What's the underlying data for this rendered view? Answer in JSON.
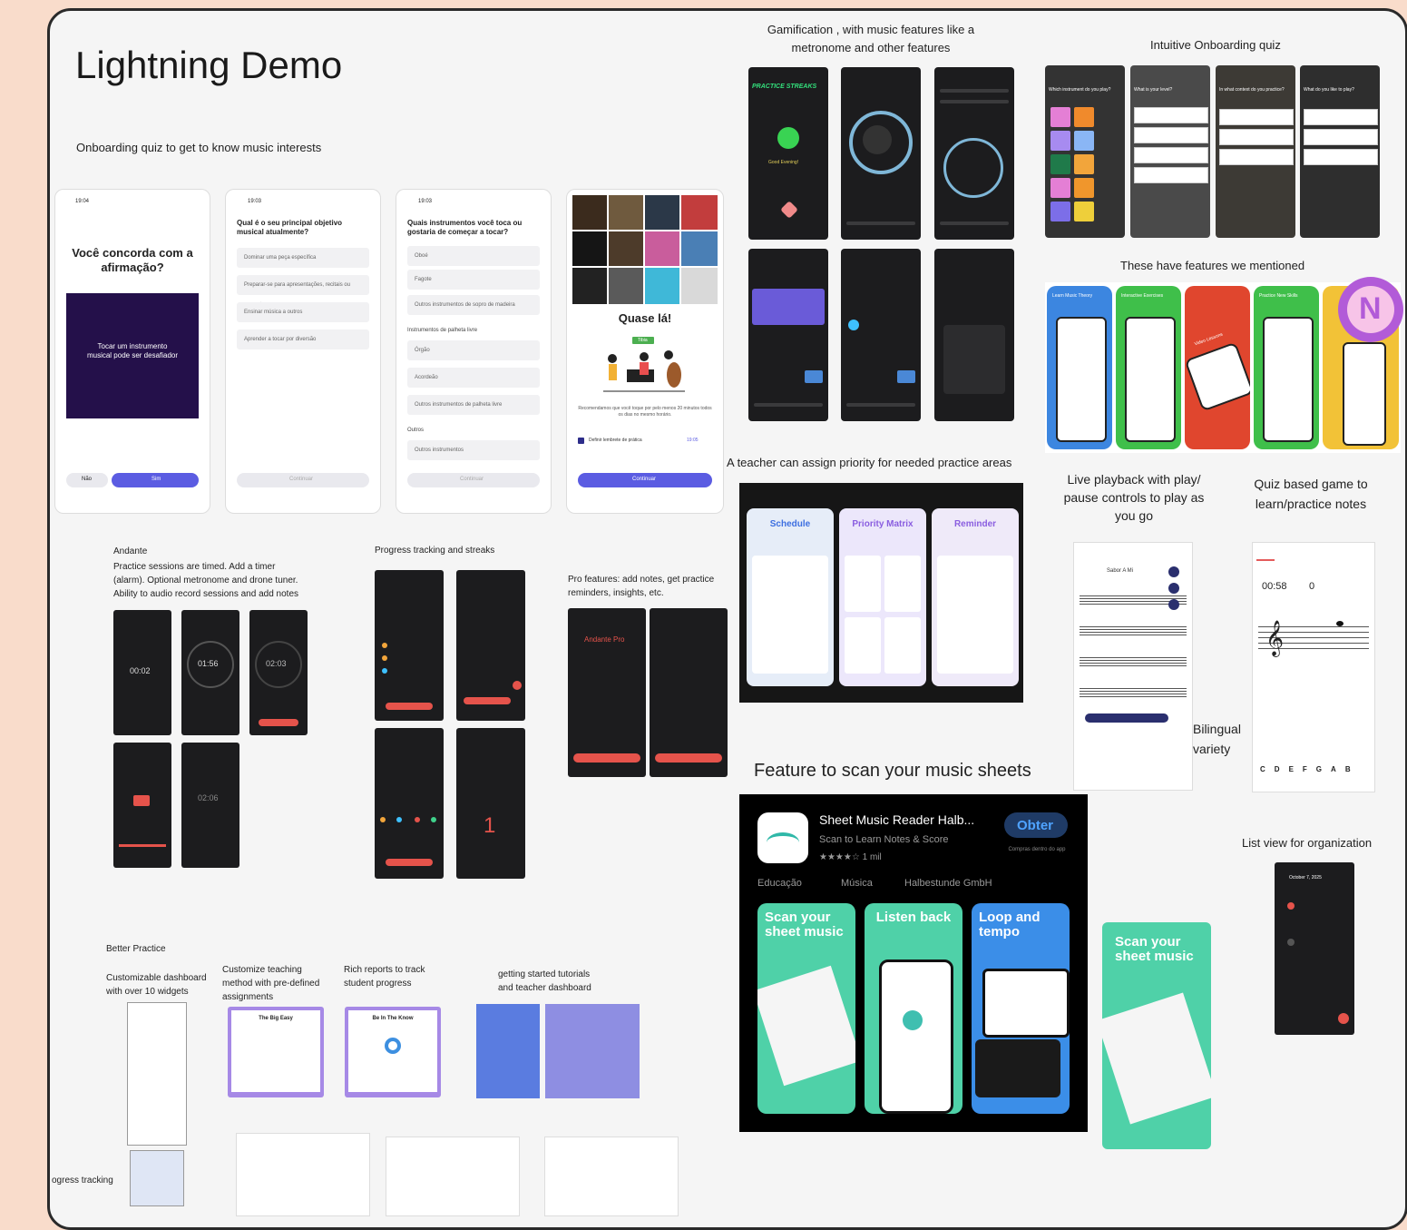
{
  "board": {
    "title": "Lightning Demo",
    "onboarding_caption": "Onboarding quiz to get to know music interests",
    "gamification_caption_1": "Gamification , with music features like a",
    "gamification_caption_2": "metronome and other features",
    "intuitive_quiz_caption": "Intuitive Onboarding quiz",
    "features_mentioned_caption": "These have features we mentioned",
    "teacher_priority_caption": "A teacher can assign priority for needed practice areas",
    "live_playback_caption_1": "Live playback with play/",
    "live_playback_caption_2": "pause controls to play as",
    "live_playback_caption_3": "you go",
    "quiz_game_caption_1": "Quiz based game to",
    "quiz_game_caption_2": "learn/practice notes",
    "bilingual_caption_1": "Bilingual",
    "bilingual_caption_2": "variety",
    "scan_caption": "Feature to scan your music sheets",
    "list_view_caption": "List view for organization",
    "andante_title": "Andante",
    "andante_desc_1": "Practice sessions are timed. Add a timer",
    "andante_desc_2": "(alarm). Optional metronome and drone tuner.",
    "andante_desc_3": "Ability to audio record sessions and add notes",
    "progress_caption": "Progress tracking and streaks",
    "pro_caption_1": "Pro features: add notes, get practice",
    "pro_caption_2": "reminders, insights, etc.",
    "better_practice": "Better Practice",
    "dashboard_caption_1": "Customizable dashboard",
    "dashboard_caption_2": "with over 10 widgets",
    "teaching_caption_1": "Customize teaching",
    "teaching_caption_2": "method with pre-defined",
    "teaching_caption_3": "assignments",
    "reports_caption_1": "Rich reports to track",
    "reports_caption_2": "student progress",
    "tutorials_caption_1": "getting started tutorials",
    "tutorials_caption_2": "and teacher dashboard",
    "bottom_cut_label": "ogress tracking"
  },
  "onboarding": {
    "screen1_time": "19:04",
    "screen1_title": "Você concorda com a afirmação?",
    "screen1_quote": "Tocar um instrumento musical pode ser desafiador",
    "screen1_no": "Não",
    "screen1_yes": "Sim",
    "screen2_time": "19:03",
    "screen2_title": "Qual é o seu principal objetivo musical atualmente?",
    "screen2_options": [
      "Dominar uma peça específica",
      "Preparar-se para apresentações, recitais ou concertos",
      "Ensinar música a outros",
      "Aprender a tocar por diversão"
    ],
    "screen2_continue": "Continuar",
    "screen3_time": "19:03",
    "screen3_title": "Quais instrumentos você toca ou gostaria de começar a tocar?",
    "screen3_options": [
      "Oboé",
      "Fagote",
      "Outros instrumentos de sopro de madeira",
      "Órgão",
      "Acordeão",
      "Outros instrumentos de palheta livre",
      "Outros instrumentos"
    ],
    "screen3_section_1": "Instrumentos de palheta livre",
    "screen3_section_2": "Outros",
    "screen3_continue": "Continuar",
    "screen4_title": "Quase lá!",
    "screen4_badge": "Tibia",
    "screen4_text": "Recomendamos que você toque por pelo menos 20 minutos todos os dias no mesmo horário.",
    "screen4_reminder": "Definir lembrete de prática",
    "screen4_reminder_time": "19:05",
    "screen4_continue": "Continuar"
  },
  "gamification": {
    "streak_title": "PRACTICE STREAKS",
    "streak_footer": "Good Evening!"
  },
  "andante": {
    "timers": [
      "00:02",
      "01:56",
      "02:03",
      "02:06"
    ]
  },
  "progress": {
    "countdown": "1"
  },
  "pro": {
    "title": "Andante Pro"
  },
  "priority": {
    "tabs": [
      "Schedule",
      "Priority Matrix",
      "Reminder"
    ]
  },
  "quiz_game": {
    "time": "00:58",
    "score": "0",
    "notes": [
      "C",
      "D",
      "E",
      "F",
      "G",
      "A",
      "B"
    ]
  },
  "playback": {
    "sheet_title": "Sabor A Mi"
  },
  "scan_app": {
    "name": "Sheet Music Reader Halb...",
    "subtitle": "Scan to Learn Notes & Score",
    "rating": "★★★★☆ 1 mil",
    "get_button": "Obter",
    "in_app": "Compras dentro do app",
    "category": "Educação",
    "genre": "Música",
    "developer": "Halbestunde GmbH",
    "panel1": "Scan your sheet music",
    "panel2": "Listen back",
    "panel3": "Loop and tempo",
    "panel4": "Scan your sheet music"
  },
  "list_view": {
    "date": "October 7, 2025"
  },
  "dashboards": {
    "teaching_card": "The Big Easy",
    "reports_card": "Be In The Know"
  },
  "features_screens": [
    "Learn Music Theory",
    "Interactive Exercises",
    "Video Lessons",
    "Practice New Skills"
  ],
  "quiz_screens": [
    "Which instrument do you play?",
    "What is your level?",
    "In what context do you practice?",
    "What do you like to play?"
  ],
  "colors": {
    "accent": "#5b5ce2",
    "onboarding_quote_bg": "#24104a",
    "avatar": "#b25bd8",
    "scan_green": "#4fd1a8",
    "scan_blue": "#3b8ee8",
    "andante_red": "#e5534b"
  }
}
